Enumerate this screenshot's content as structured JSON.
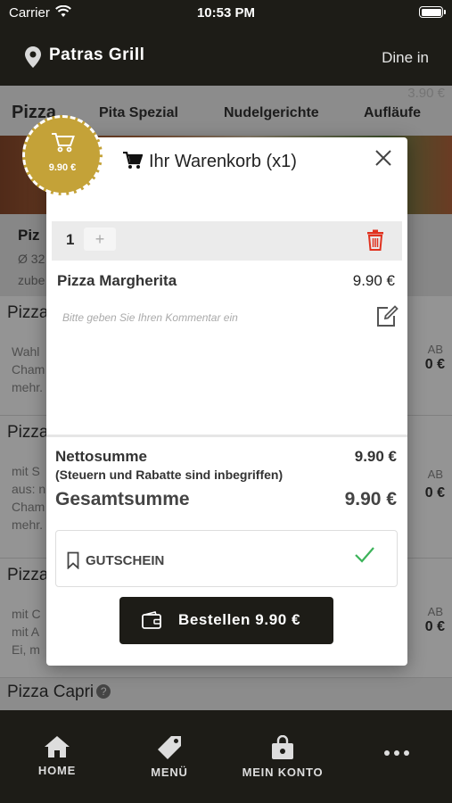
{
  "status_bar": {
    "carrier": "Carrier",
    "time": "10:53 PM"
  },
  "header": {
    "restaurant_name": "Patras Grill",
    "mode": "Dine in"
  },
  "background": {
    "ghost_price": "3.90 €",
    "tabs": [
      {
        "label": "Pizza"
      },
      {
        "label": "Pita Spezial"
      },
      {
        "label": "Nudelgerichte"
      },
      {
        "label": "Aufläufe"
      }
    ],
    "category": {
      "title": "Piz",
      "line1": "Ø 32",
      "line2": "zube"
    },
    "items": [
      {
        "name": "Pizza",
        "desc1": "Wahl",
        "desc2": "Cham",
        "desc3": "mehr.",
        "ab": "AB",
        "price": "0 €"
      },
      {
        "name": "Pizza",
        "desc1": "mit S",
        "desc2": "aus: n",
        "desc3": "Cham",
        "desc4": "mehr.",
        "ab": "AB",
        "price": "0 €"
      },
      {
        "name": "Pizza",
        "desc1": "mit C",
        "desc2": "mit A",
        "desc3": "Ei, m",
        "ab": "AB",
        "price": "0 €"
      }
    ],
    "last_item": "Pizza Capri"
  },
  "badge": {
    "price": "9.90 €"
  },
  "cart_modal": {
    "title": "Ihr Warenkorb (x1)",
    "quantity": "1",
    "plus": "+",
    "item_name": "Pizza Margherita",
    "item_price": "9.90 €",
    "comment_placeholder": "Bitte geben Sie Ihren Kommentar ein",
    "net_label": "Nettosumme",
    "net_value": "9.90 €",
    "tax_note": "(Steuern und Rabatte sind inbegriffen)",
    "total_label": "Gesamtsumme",
    "total_value": "9.90 €",
    "voucher_label": "GUTSCHEIN",
    "order_button": "Bestellen 9.90 €"
  },
  "tab_bar": [
    {
      "label": "HOME",
      "icon": "home-icon"
    },
    {
      "label": "MENÜ",
      "icon": "tag-icon"
    },
    {
      "label": "MEIN KONTO",
      "icon": "bag-icon"
    },
    {
      "label": "",
      "icon": "more-icon"
    }
  ],
  "colors": {
    "dark": "#1d1c17",
    "gold": "#c4a238",
    "trash_red": "#e0321f",
    "check_green": "#3cb35a"
  }
}
